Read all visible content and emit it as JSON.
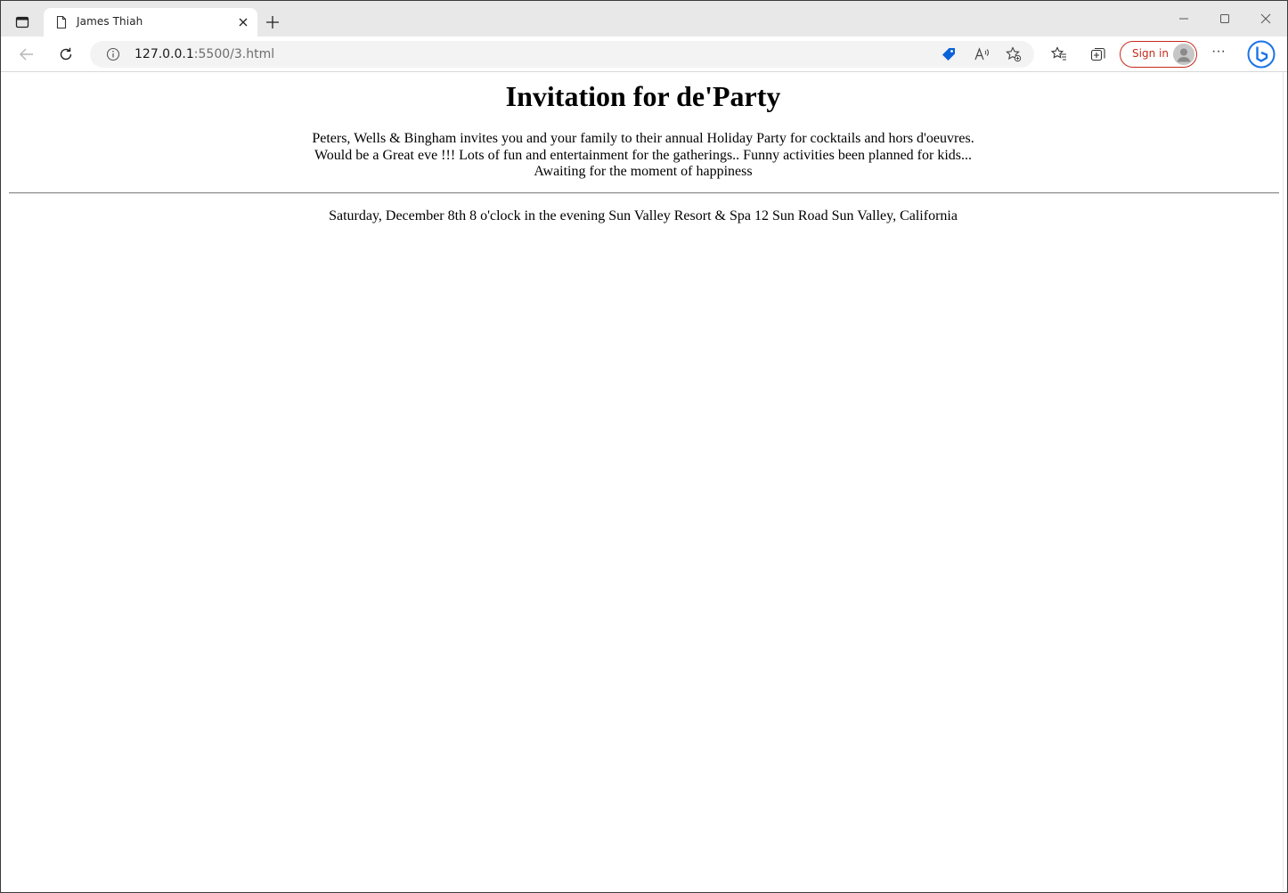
{
  "browser": {
    "tab": {
      "title": "James Thiah"
    },
    "address_bar": {
      "host": "127.0.0.1",
      "path": ":5500/3.html"
    },
    "signin_label": "Sign in",
    "more_label": "···"
  },
  "page": {
    "heading": "Invitation for de'Party",
    "intro_lines": [
      "Peters, Wells & Bingham invites you and your family to their annual Holiday Party for cocktails and hors d'oeuvres.",
      "Would be a Great eve !!! Lots of fun and entertainment for the gatherings.. Funny activities been planned for kids...",
      "Awaiting for the moment of happiness"
    ],
    "details": "Saturday, December 8th 8 o'clock in the evening Sun Valley Resort & Spa 12 Sun Road Sun Valley, California"
  },
  "colors": {
    "signin_accent": "#c42b1c",
    "tag_icon": "#0a63d8",
    "bing_blue": "#1a73e8"
  },
  "icons": [
    "tab-actions-icon",
    "page-icon",
    "close-icon",
    "plus-icon",
    "minimize-icon",
    "maximize-icon",
    "window-close-icon",
    "back-icon",
    "refresh-icon",
    "info-icon",
    "shopping-tag-icon",
    "read-aloud-icon",
    "add-favorite-icon",
    "favorites-icon",
    "collections-icon",
    "profile-avatar-icon",
    "more-icon",
    "bing-icon"
  ]
}
